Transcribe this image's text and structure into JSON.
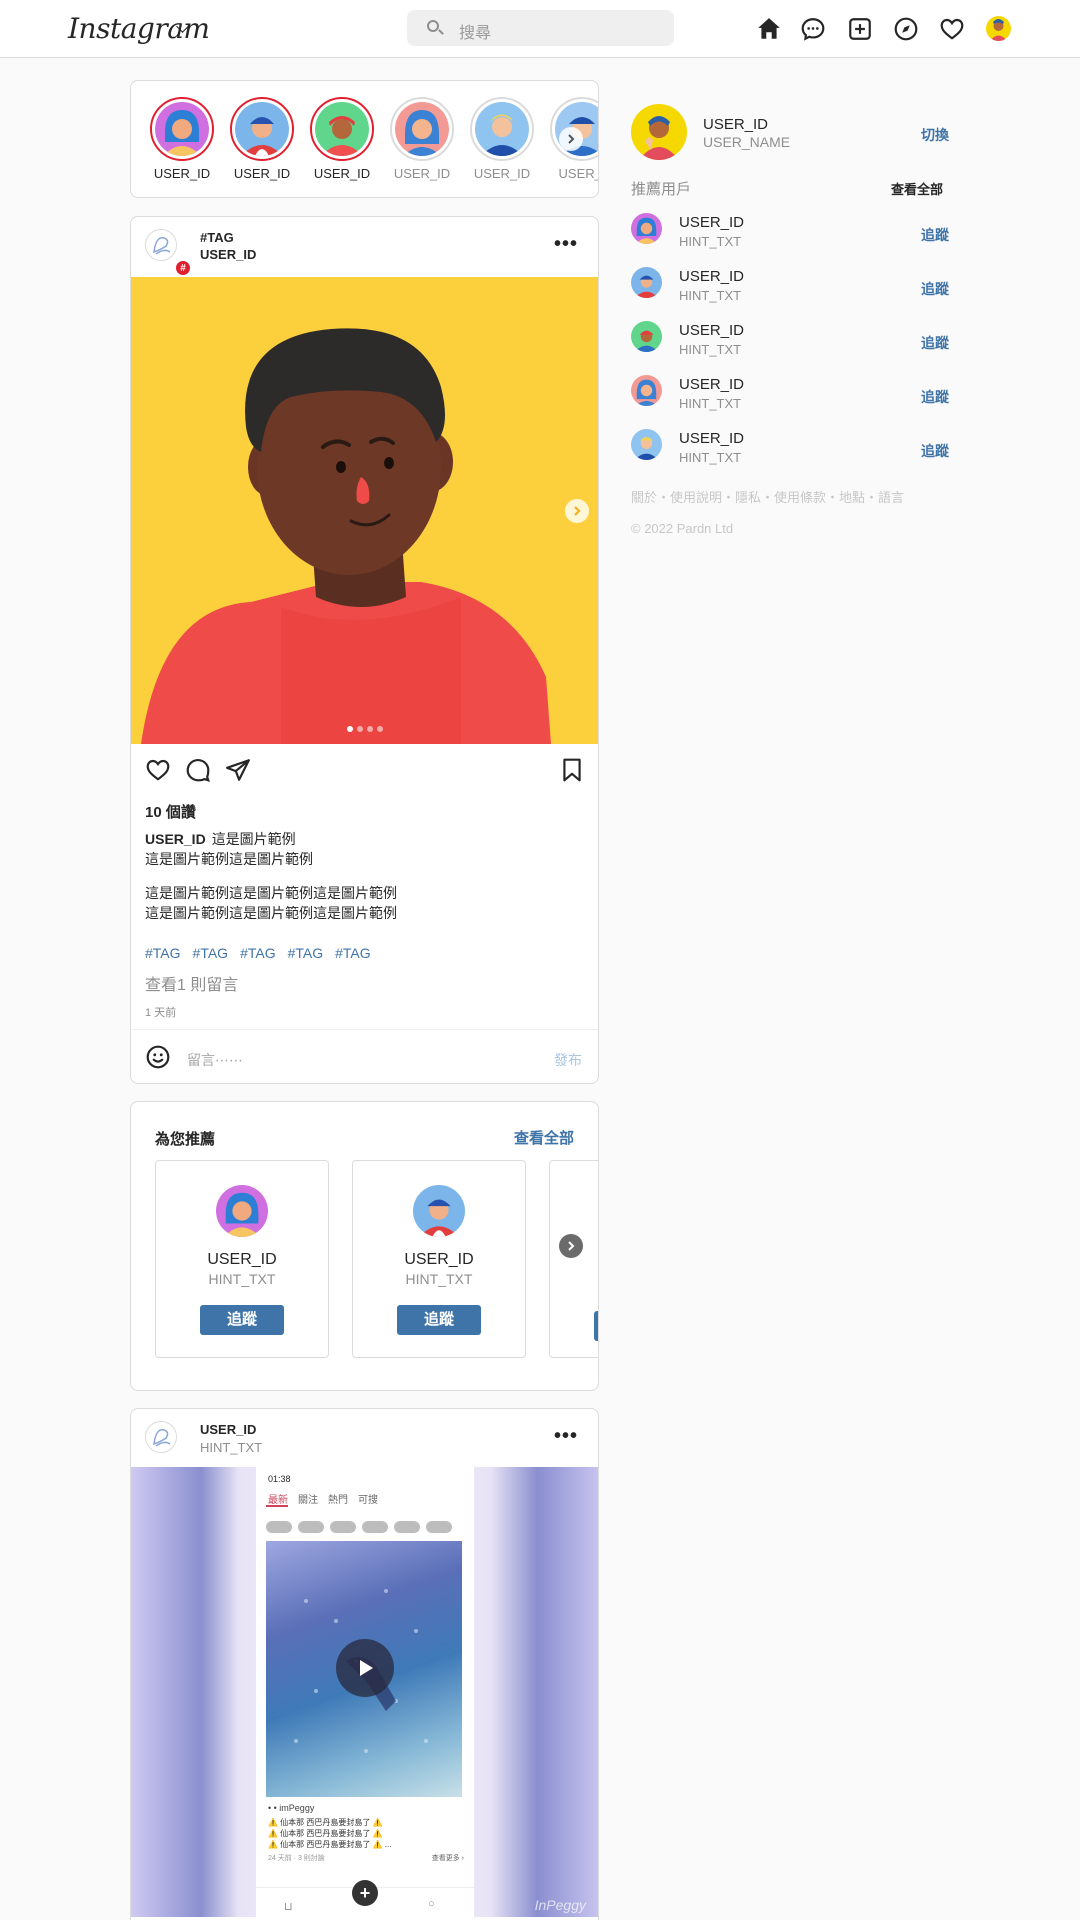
{
  "header": {
    "logo": "Instagram",
    "search_placeholder": "搜尋"
  },
  "stories": [
    {
      "label": "USER_ID",
      "seen": false
    },
    {
      "label": "USER_ID",
      "seen": false
    },
    {
      "label": "USER_ID",
      "seen": false
    },
    {
      "label": "USER_ID",
      "seen": true
    },
    {
      "label": "USER_ID",
      "seen": true
    },
    {
      "label": "USER_I",
      "seen": true
    }
  ],
  "post1": {
    "tag": "#TAG",
    "user": "USER_ID",
    "likes": "10 個讚",
    "caption_user": "USER_ID",
    "caption_line1": "這是圖片範例",
    "caption_line2": "這是圖片範例這是圖片範例",
    "caption_line3": "這是圖片範例這是圖片範例這是圖片範例",
    "caption_line4": "這是圖片範例這是圖片範例這是圖片範例",
    "hashtags": [
      "#TAG",
      "#TAG",
      "#TAG",
      "#TAG",
      "#TAG"
    ],
    "view_comments": "查看1 則留言",
    "time": "1 天前",
    "comment_placeholder": "留言⋯⋯",
    "publish": "發布"
  },
  "recommend": {
    "title": "為您推薦",
    "see_all": "查看全部",
    "cards": [
      {
        "name": "USER_ID",
        "hint": "HINT_TXT",
        "follow": "追蹤"
      },
      {
        "name": "USER_ID",
        "hint": "HINT_TXT",
        "follow": "追蹤"
      }
    ]
  },
  "post2": {
    "user": "USER_ID",
    "hint": "HINT_TXT",
    "phone_time": "01:38",
    "phone_tabs": [
      "最新",
      "關注",
      "熱門",
      "可搜"
    ],
    "phone_user": "• • imPeggy",
    "phone_lines": [
      "⚠️ 仙本那 西巴丹島要封島了 ⚠️",
      "⚠️ 仙本那 西巴丹島要封島了 ⚠️",
      "⚠️ 仙本那 西巴丹島要封島了 ⚠️ ..."
    ],
    "phone_meta": "24 天前 · 3 則討論",
    "phone_more": "查看更多 ›",
    "watermark": "InPeggy"
  },
  "sidebar": {
    "me": {
      "id": "USER_ID",
      "name": "USER_NAME",
      "switch": "切換"
    },
    "suggest_title": "推薦用戶",
    "suggest_all": "查看全部",
    "users": [
      {
        "id": "USER_ID",
        "hint": "HINT_TXT",
        "follow": "追蹤"
      },
      {
        "id": "USER_ID",
        "hint": "HINT_TXT",
        "follow": "追蹤"
      },
      {
        "id": "USER_ID",
        "hint": "HINT_TXT",
        "follow": "追蹤"
      },
      {
        "id": "USER_ID",
        "hint": "HINT_TXT",
        "follow": "追蹤"
      },
      {
        "id": "USER_ID",
        "hint": "HINT_TXT",
        "follow": "追蹤"
      }
    ],
    "footer_links": "關於・使用說明・隱私・使用條款・地點・語言",
    "copyright": "© 2022 Pardn Ltd"
  },
  "colors": {
    "link_blue": "#3f74a8",
    "story_ring_red": "#e0202e",
    "hero_yellow": "#fcd03d",
    "shirt_red": "#ef4b48"
  }
}
